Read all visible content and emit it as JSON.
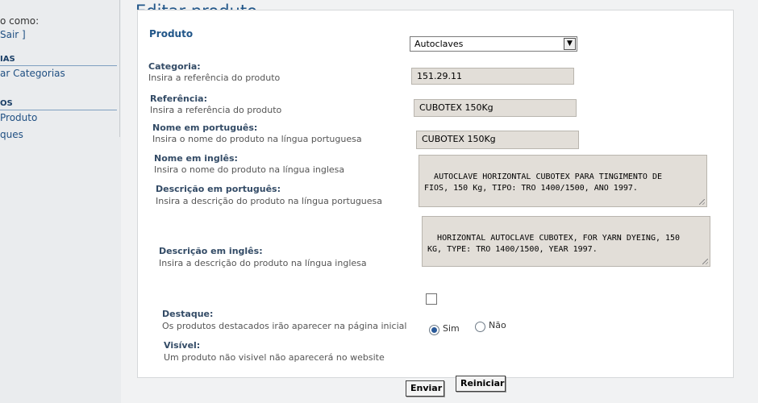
{
  "sidebar": {
    "login_label": "o como:",
    "logout_link": "Sair ]",
    "section_categories": "IAS",
    "categories_link": "ar Categorias",
    "section_products": "OS",
    "product_link": "Produto",
    "other_link": "ques"
  },
  "page": {
    "title": "Editar produto",
    "legend": "Produto"
  },
  "form": {
    "category": {
      "label": "Categoria:",
      "hint": "Insira a referência do produto",
      "value": "Autoclaves"
    },
    "reference": {
      "label": "Referência:",
      "hint": "Insira a referência do produto",
      "value": "151.29.11"
    },
    "name_pt": {
      "label": "Nome em português:",
      "hint": "Insira o nome do produto na língua portuguesa",
      "value": "CUBOTEX 150Kg"
    },
    "name_en": {
      "label": "Nome em inglês:",
      "hint": "Insira o nome do produto na língua inglesa",
      "value": "CUBOTEX 150Kg"
    },
    "desc_pt": {
      "label": "Descrição em português:",
      "hint": "Insira a descrição do produto na língua portuguesa",
      "value": "AUTOCLAVE HORIZONTAL CUBOTEX PARA TINGIMENTO DE\nFIOS, 150 Kg, TIPO: TRO 1400/1500, ANO 1997."
    },
    "desc_en": {
      "label": "Descrição em inglês:",
      "hint": "Insira a descrição do produto na língua inglesa",
      "value": "HORIZONTAL AUTOCLAVE CUBOTEX, FOR YARN DYEING, 150\nKG, TYPE: TRO 1400/1500, YEAR 1997."
    },
    "featured": {
      "label": "Destaque:",
      "hint": "Os produtos destacados irão aparecer na página inicial",
      "checked": false
    },
    "visible": {
      "label": "Visível:",
      "hint": "Um produto não visivel não aparecerá no website",
      "yes": "Sim",
      "no": "Não",
      "selected": "Sim"
    }
  },
  "buttons": {
    "submit": "Enviar",
    "reset": "Reiniciar"
  }
}
